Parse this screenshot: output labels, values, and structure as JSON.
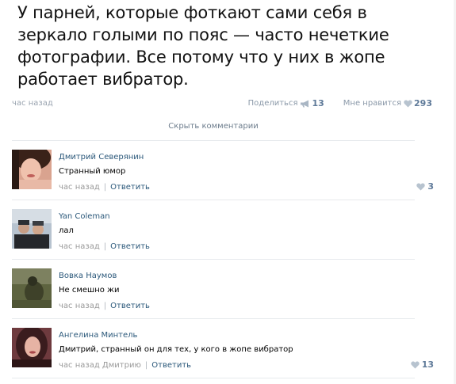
{
  "post": {
    "text": "У парней, которые фоткают сами себя в зеркало голыми по пояс — часто нечеткие фотографии. Все потому что у них в жопе работает вибратор.",
    "time": "час назад",
    "share_label": "Поделиться",
    "share_count": "13",
    "like_label": "Мне нравится",
    "like_count": "293"
  },
  "hide_comments_label": "Скрыть комментарии",
  "comments": [
    {
      "author": "Дмитрий Северянин",
      "text": "Странный юмор",
      "time": "час назад",
      "reply_label": "Ответить",
      "likes": "3"
    },
    {
      "author": "Yan Coleman",
      "text": "лал",
      "time": "час назад",
      "reply_label": "Ответить",
      "likes": ""
    },
    {
      "author": "Вовка Наумов",
      "text": "Не смешно жи",
      "time": "час назад",
      "reply_label": "Ответить",
      "likes": ""
    },
    {
      "author": "Ангелина Минтель",
      "text": "Дмитрий, странный он для тех, у кого в жопе вибратор",
      "time": "час назад Дмитрию",
      "reply_label": "Ответить",
      "likes": "13"
    }
  ],
  "colors": {
    "link": "#2b587a",
    "meta": "#999999",
    "like_accent": "#5f7a99"
  },
  "icons": {
    "share": "megaphone-icon",
    "like": "heart-icon"
  }
}
